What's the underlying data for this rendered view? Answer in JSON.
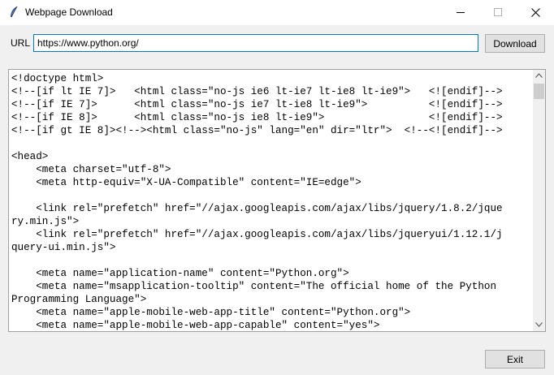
{
  "window": {
    "title": "Webpage Download"
  },
  "form": {
    "url_label": "URL",
    "url_value": "https://www.python.org/",
    "download_label": "Download",
    "exit_label": "Exit"
  },
  "content": {
    "lines": [
      "<!doctype html>",
      "<!--[if lt IE 7]>   <html class=\"no-js ie6 lt-ie7 lt-ie8 lt-ie9\">   <![endif]-->",
      "<!--[if IE 7]>      <html class=\"no-js ie7 lt-ie8 lt-ie9\">          <![endif]-->",
      "<!--[if IE 8]>      <html class=\"no-js ie8 lt-ie9\">                 <![endif]-->",
      "<!--[if gt IE 8]><!--><html class=\"no-js\" lang=\"en\" dir=\"ltr\">  <!--<![endif]-->",
      "",
      "<head>",
      "    <meta charset=\"utf-8\">",
      "    <meta http-equiv=\"X-UA-Compatible\" content=\"IE=edge\">",
      "",
      "    <link rel=\"prefetch\" href=\"//ajax.googleapis.com/ajax/libs/jquery/1.8.2/jque",
      "ry.min.js\">",
      "    <link rel=\"prefetch\" href=\"//ajax.googleapis.com/ajax/libs/jqueryui/1.12.1/j",
      "query-ui.min.js\">",
      "",
      "    <meta name=\"application-name\" content=\"Python.org\">",
      "    <meta name=\"msapplication-tooltip\" content=\"The official home of the Python",
      "Programming Language\">",
      "    <meta name=\"apple-mobile-web-app-title\" content=\"Python.org\">",
      "    <meta name=\"apple-mobile-web-app-capable\" content=\"yes\">"
    ]
  }
}
